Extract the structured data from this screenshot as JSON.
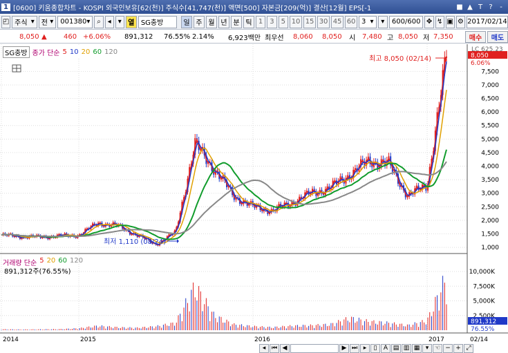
{
  "title": {
    "screen_no": "1",
    "text": "[0600] 키움종합차트 - KOSPI 외국인보유[62(천)] 주식수[41,747(천)] 액면[500] 자본금[209(억)] 결산[12월] EPS[-1",
    "controls": [
      "■",
      "▲",
      "T",
      "?",
      "-"
    ]
  },
  "toolbar": {
    "market": "주식",
    "prefix": "전",
    "code": "001380",
    "stock_label": "열",
    "stock_name": "SG충방",
    "periods": [
      "일",
      "주",
      "월",
      "년",
      "분",
      "틱"
    ],
    "active_period": "일",
    "intervals": [
      "1",
      "3",
      "5",
      "10",
      "15",
      "30",
      "45",
      "60"
    ],
    "custom_interval": "3",
    "count": "600",
    "count_total": "/600",
    "date": "2017/02/14"
  },
  "quote": {
    "price": "8,050",
    "arrow": "▲",
    "change": "460",
    "change_pct": "+6.06%",
    "volume": "891,312",
    "vol_ratio": "76.55%",
    "turnover": "2.14%",
    "amount": "6,923백만",
    "best_ask_label": "최우선",
    "best_ask": "8,060",
    "best_bid": "8,050",
    "open_label": "시",
    "open": "7,480",
    "high_label": "고",
    "high": "8,050",
    "low_label": "저",
    "low": "7,350",
    "buy_button": "매수",
    "sell_button": "매도"
  },
  "legend": {
    "name": "SG충방",
    "price_label": "종가 단순",
    "ma": [
      "5",
      "10",
      "20",
      "60",
      "120"
    ],
    "ma_colors": [
      "#e0201f",
      "#2039c8",
      "#e0a000",
      "#119c2c",
      "#888888"
    ],
    "volume_label": "거래량 단순",
    "volume_ma": [
      "5",
      "20",
      "60",
      "120"
    ],
    "volume_value": "891,312주(76.55%)"
  },
  "annotations": {
    "high": "최고 8,050 (02/14)",
    "low": "최저 1,110 (08/24)"
  },
  "axis": {
    "price_ticks": [
      "7,500",
      "7,000",
      "6,500",
      "6,000",
      "5,500",
      "5,000",
      "4,500",
      "4,000",
      "3,500",
      "3,000",
      "2,500",
      "2,000",
      "1,500",
      "1,000"
    ],
    "price_flags": [
      "8,050",
      "6.06%"
    ],
    "price_top_note": "LC 625.23",
    "volume_ticks": [
      "10,000K",
      "7,500K",
      "5,000K",
      "2,500K"
    ],
    "volume_flags": [
      "891,312",
      "76.55%"
    ],
    "x_ticks": [
      "2014",
      "2015",
      "2016",
      "2017"
    ],
    "x_right": "02/14"
  },
  "chart_data": {
    "type": "line",
    "title": "SG충방",
    "x": [
      "2014-01",
      "2014-04",
      "2014-07",
      "2014-10",
      "2015-01",
      "2015-04",
      "2015-06",
      "2015-07",
      "2015-08-24",
      "2015-09",
      "2015-10",
      "2015-11",
      "2015-12",
      "2016-01",
      "2016-03",
      "2016-05",
      "2016-06",
      "2016-08",
      "2016-09",
      "2016-10",
      "2016-11",
      "2016-12",
      "2017-01",
      "2017-02-14"
    ],
    "series": [
      {
        "name": "종가",
        "values": [
          1450,
          1400,
          1380,
          1420,
          1450,
          1900,
          1800,
          1450,
          1110,
          1550,
          4800,
          3900,
          2900,
          2500,
          2350,
          2650,
          3000,
          3200,
          3700,
          4200,
          4100,
          2900,
          3300,
          8050
        ]
      }
    ],
    "volume": {
      "name": "거래량",
      "values_k": [
        200,
        150,
        180,
        220,
        400,
        900,
        600,
        500,
        800,
        1500,
        9000,
        3000,
        1200,
        800,
        600,
        900,
        1000,
        1200,
        2500,
        1800,
        1500,
        1000,
        2000,
        11000
      ]
    },
    "ylim": [
      900,
      8300
    ],
    "volume_ylim": [
      0,
      12000
    ],
    "grid": true,
    "ylabel": "",
    "xlabel": ""
  }
}
